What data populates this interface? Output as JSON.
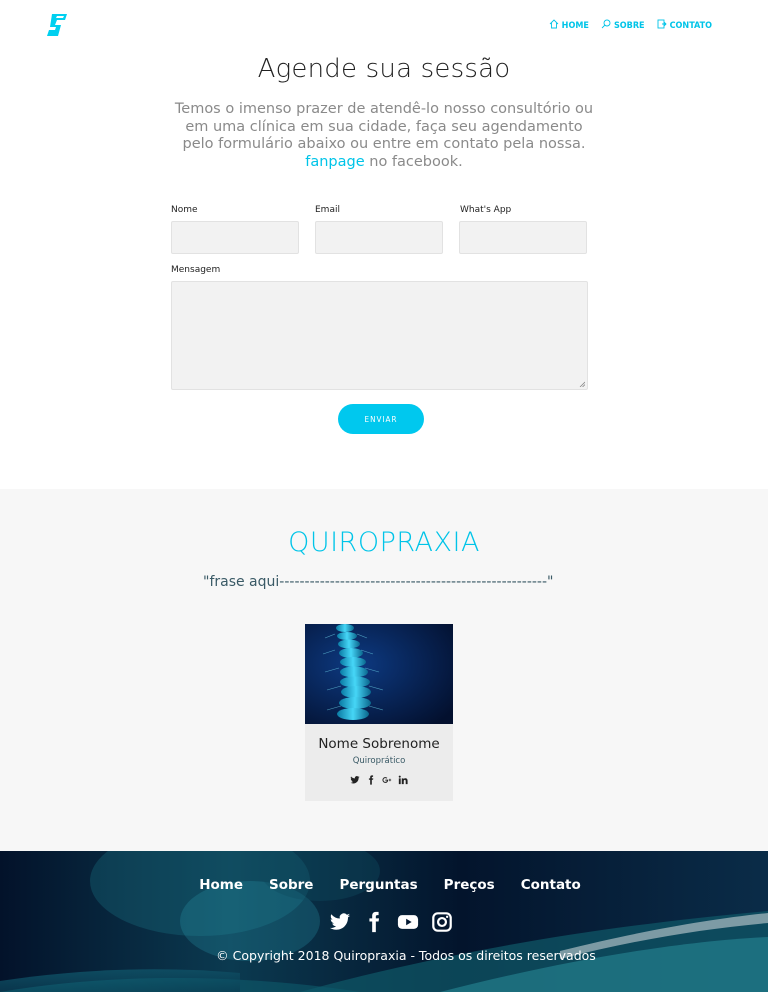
{
  "header": {
    "nav": [
      {
        "label": "HOME",
        "icon": "home-icon"
      },
      {
        "label": "SOBRE",
        "icon": "search-icon"
      },
      {
        "label": "CONTATO",
        "icon": "contact-icon"
      }
    ]
  },
  "appointment": {
    "title": "Agende sua sessão",
    "intro": "Temos o imenso prazer de atendê-lo nosso consultório ou em uma clínica em sua cidade, faça seu agendamento pelo formulário abaixo ou entre em contato pela nossa.",
    "link_text": "fanpage",
    "intro_end": "no facebook.",
    "fields": {
      "name_label": "Nome",
      "email_label": "Email",
      "whatsapp_label": "What's App",
      "message_label": "Mensagem"
    },
    "values": {
      "name": "",
      "email": "",
      "whatsapp": "",
      "message": ""
    },
    "send_label": "ENVIAR"
  },
  "quiropraxia": {
    "title": "QUIROPRAXIA",
    "phrase": "\"frase aqui-----------------------------------------------------\"",
    "profile": {
      "name": "Nome Sobrenome",
      "role": "Quiroprático",
      "social": [
        "twitter-icon",
        "facebook-icon",
        "google-plus-icon",
        "linkedin-icon"
      ]
    }
  },
  "footer": {
    "nav": [
      {
        "label": "Home"
      },
      {
        "label": "Sobre"
      },
      {
        "label": "Perguntas"
      },
      {
        "label": "Preços"
      },
      {
        "label": "Contato"
      }
    ],
    "social": [
      "twitter-icon",
      "facebook-icon",
      "youtube-icon",
      "instagram-icon"
    ],
    "copyright": "© Copyright 2018 Quiropraxia - Todos os direitos reservados"
  },
  "colors": {
    "accent": "#00c4e8",
    "section_bg": "#f7f7f7",
    "footer_bg": "#041a33"
  }
}
